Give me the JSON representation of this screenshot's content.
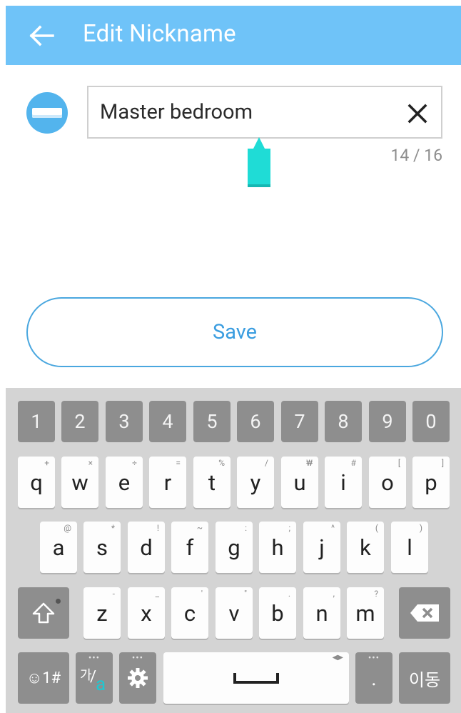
{
  "appbar": {
    "title": "Edit Nickname",
    "back_icon": "arrow-left-icon"
  },
  "device": {
    "icon": "air-conditioner-icon"
  },
  "nickname_input": {
    "value": "Master bedroom",
    "counter": "14 / 16",
    "clear_icon": "close-icon"
  },
  "save_button": {
    "label": "Save"
  },
  "keyboard": {
    "number_row": [
      "1",
      "2",
      "3",
      "4",
      "5",
      "6",
      "7",
      "8",
      "9",
      "0"
    ],
    "row1": [
      {
        "label": "q",
        "hint": "+"
      },
      {
        "label": "w",
        "hint": "×"
      },
      {
        "label": "e",
        "hint": "÷"
      },
      {
        "label": "r",
        "hint": "="
      },
      {
        "label": "t",
        "hint": "%"
      },
      {
        "label": "y",
        "hint": "/"
      },
      {
        "label": "u",
        "hint": "₩"
      },
      {
        "label": "i",
        "hint": "#"
      },
      {
        "label": "o",
        "hint": "["
      },
      {
        "label": "p",
        "hint": "]"
      }
    ],
    "row2": [
      {
        "label": "a",
        "hint": "@"
      },
      {
        "label": "s",
        "hint": "*"
      },
      {
        "label": "d",
        "hint": "!"
      },
      {
        "label": "f",
        "hint": "~"
      },
      {
        "label": "g",
        "hint": ":"
      },
      {
        "label": "h",
        "hint": ";"
      },
      {
        "label": "j",
        "hint": "^"
      },
      {
        "label": "k",
        "hint": "("
      },
      {
        "label": "l",
        "hint": ")"
      }
    ],
    "row3": [
      {
        "label": "z",
        "hint": "-"
      },
      {
        "label": "x",
        "hint": "_"
      },
      {
        "label": "c",
        "hint": "'"
      },
      {
        "label": "v",
        "hint": "\""
      },
      {
        "label": "b",
        "hint": "."
      },
      {
        "label": "n",
        "hint": ","
      },
      {
        "label": "m",
        "hint": "?"
      }
    ],
    "emoji_key": "☺1#",
    "lang_key_top": "가",
    "lang_key_bottom": "a",
    "period_key": ".",
    "enter_key": "이동",
    "shift_icon": "shift-icon",
    "backspace_icon": "backspace-icon",
    "settings_icon": "gear-icon",
    "space_icon": "space-bar-icon",
    "accent_color": "#1ec8d2"
  }
}
